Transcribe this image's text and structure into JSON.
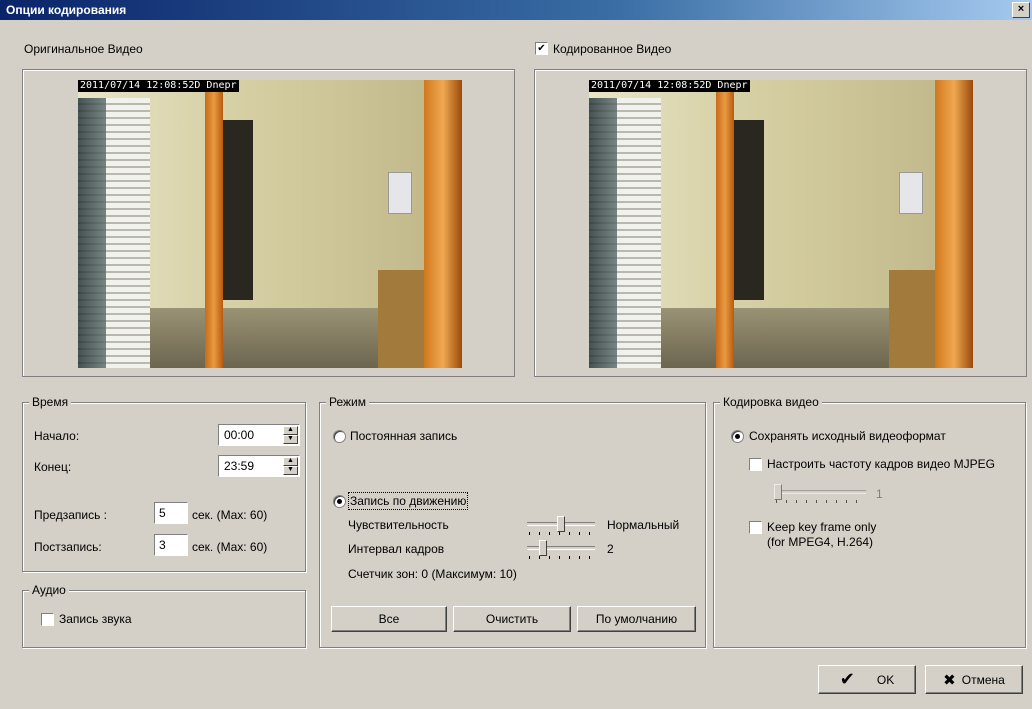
{
  "window": {
    "title": "Опции кодирования",
    "close_glyph": "×"
  },
  "original": {
    "label": "Оригинальное Видео",
    "osd": "2011/07/14 12:08:52D Dnepr"
  },
  "encoded": {
    "label": "Кодированное Видео",
    "checked": true,
    "check_glyph": "✔",
    "osd": "2011/07/14 12:08:52D Dnepr"
  },
  "time": {
    "legend": "Время",
    "start_label": "Начало:",
    "start_value": "00:00",
    "end_label": "Конец:",
    "end_value": "23:59",
    "pre_label": "Предзапись :",
    "pre_value": "5",
    "pre_unit": "сек.  (Max: 60)",
    "post_label": "Постзапись:",
    "post_value": "3",
    "post_unit": "сек.  (Max: 60)"
  },
  "audio": {
    "legend": "Аудио",
    "record_label": "Запись звука",
    "checked": false
  },
  "mode": {
    "legend": "Режим",
    "continuous_label": "Постоянная запись",
    "motion_label": "Запись по движению",
    "selected": "motion",
    "sensitivity_label": "Чувствительность",
    "sensitivity_value": "Нормальный",
    "sensitivity_level": 0.5,
    "interval_label": "Интервал кадров",
    "interval_value": "2",
    "interval_level": 0.2,
    "zones_label": "Счетчик зон: 0  (Максимум: 10)",
    "buttons": {
      "all": "Все",
      "clear": "Очистить",
      "default": "По умолчанию"
    }
  },
  "encoding": {
    "legend": "Кодировка видео",
    "keep_format_label": "Сохранять исходный видеоформат",
    "mjpeg_label": "Настроить частоту кадров видео MJPEG",
    "mjpeg_value": "1",
    "mjpeg_level": 0.0,
    "keyframe_label": "Keep key frame only",
    "keyframe_sub": "(for MPEG4, H.264)"
  },
  "footer": {
    "ok_label": "OK",
    "ok_glyph": "✔",
    "cancel_label": "Отмена",
    "cancel_glyph": "✖"
  },
  "colors": {
    "title_bar": "#0a246a",
    "dialog_bg": "#d4d0c8"
  },
  "icons": {
    "ok": "check-icon",
    "cancel": "x-icon",
    "spin_up": "arrow-up-icon",
    "spin_down": "arrow-down-icon"
  }
}
